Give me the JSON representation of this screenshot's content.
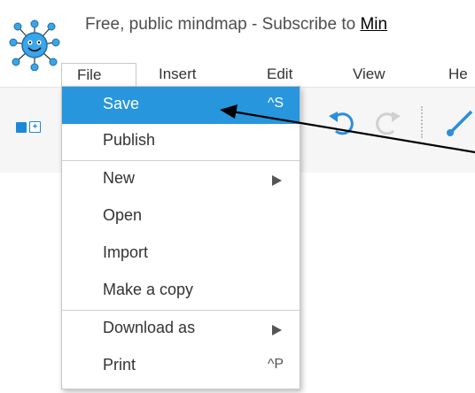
{
  "header": {
    "title_prefix": "Free, public mindmap - Subscribe to ",
    "title_link": "Min"
  },
  "menubar": {
    "file": "File",
    "insert": "Insert",
    "edit": "Edit",
    "view": "View",
    "help": "He"
  },
  "file_menu": {
    "items": [
      {
        "label": "Save",
        "shortcut": "^S",
        "selected": true
      },
      {
        "label": "Publish"
      },
      {
        "label": "New",
        "submenu": true
      },
      {
        "label": "Open"
      },
      {
        "label": "Import"
      },
      {
        "label": "Make a copy"
      },
      {
        "label": "Download as",
        "submenu": true
      },
      {
        "label": "Print",
        "shortcut": "^P"
      }
    ]
  },
  "icons": {
    "logo": "mindmap-logo-icon",
    "undo": "undo-icon",
    "redo": "redo-icon",
    "link": "connector-icon",
    "annotation": "pointer-arrow"
  },
  "colors": {
    "accent": "#2796dd",
    "icon_blue": "#1e88d8",
    "annotation": "#000000"
  }
}
